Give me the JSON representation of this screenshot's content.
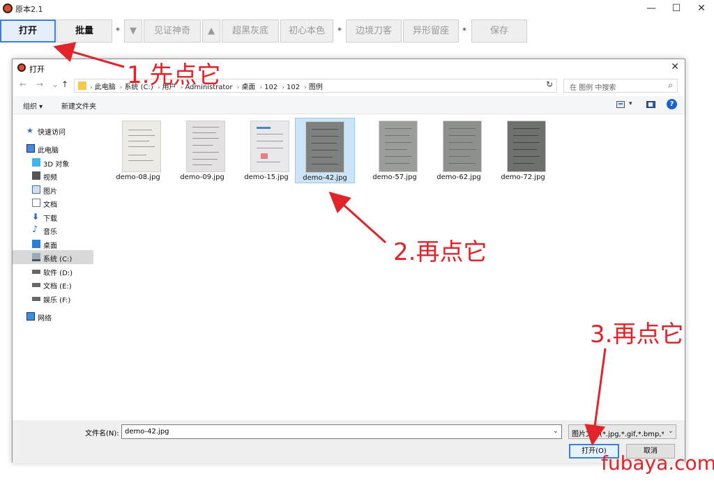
{
  "window": {
    "title": "原本2.1"
  },
  "toolbar": {
    "open": "打开",
    "batch": "批量",
    "sep": "*",
    "down": "▼",
    "up": "▲",
    "btn1": "见证神奇",
    "btn2": "超黑灰底",
    "btn3": "初心本色",
    "btn4": "边境刀客",
    "btn5": "异形留座",
    "save": "保存"
  },
  "dialog": {
    "title": "打开",
    "breadcrumb": [
      "此电脑",
      "系统 (C:)",
      "用户",
      "Administrator",
      "桌面",
      "102",
      "102",
      "图例"
    ],
    "search_placeholder": "在 图例 中搜索",
    "organize": "组织 ▾",
    "new_folder": "新建文件夹",
    "nav": {
      "quick": "快速访问",
      "pc": "此电脑",
      "obj3d": "3D 对象",
      "video": "视频",
      "pictures": "图片",
      "docs": "文档",
      "downloads": "下载",
      "music": "音乐",
      "desktop": "桌面",
      "sysc": "系统 (C:)",
      "softd": "软件 (D:)",
      "doce": "文档 (E:)",
      "entf": "娱乐 (F:)",
      "network": "网络"
    },
    "files": [
      "demo-08.jpg",
      "demo-09.jpg",
      "demo-15.jpg",
      "demo-42.jpg",
      "demo-57.jpg",
      "demo-62.jpg",
      "demo-72.jpg"
    ],
    "selected_file": "demo-42.jpg",
    "filename_label": "文件名(N):",
    "filename_value": "demo-42.jpg",
    "filetype_value": "图片文件(*.jpg,*.gif,*.bmp,*.png)",
    "ok": "打开(O)",
    "cancel": "取消"
  },
  "annotations": {
    "step1": "1.先点它",
    "step2": "2.再点它",
    "step3": "3.再点它",
    "watermark": "fubaya.com",
    "color": "#e0242a"
  }
}
